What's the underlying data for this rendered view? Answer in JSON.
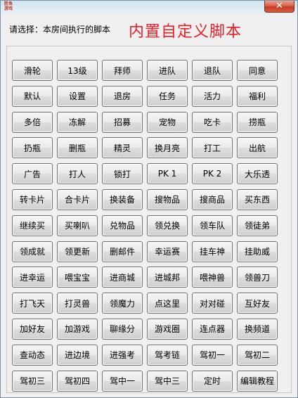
{
  "window": {
    "icon_text": "胜鱼\n游戏",
    "close_label": "✕"
  },
  "header": {
    "prompt": "请选择：本房间执行的脚本",
    "title": "内置自定义脚本"
  },
  "buttons": [
    "滑轮",
    "13级",
    "拜师",
    "进队",
    "退队",
    "同意",
    "默认",
    "设置",
    "退房",
    "任务",
    "活力",
    "福利",
    "多倍",
    "冻解",
    "招募",
    "宠物",
    "吃卡",
    "捞瓶",
    "扔瓶",
    "删瓶",
    "精灵",
    "换月亮",
    "打工",
    "出航",
    "广告",
    "打人",
    "锁打",
    "PK 1",
    "PK 2",
    "大乐透",
    "转卡片",
    "合卡片",
    "换装备",
    "搜物品",
    "搜商品",
    "买东西",
    "继续买",
    "买喇叭",
    "兑物品",
    "领兑换",
    "领车队",
    "领徒弟",
    "领成就",
    "领更新",
    "删邮件",
    "幸运赛",
    "挂车神",
    "挂助威",
    "进幸运",
    "喂宝宝",
    "进商城",
    "进城邦",
    "喂神兽",
    "领兽刀",
    "打飞天",
    "打灵兽",
    "领魔力",
    "点这里",
    "对对碰",
    "互好友",
    "加好友",
    "加游戏",
    "聊缘分",
    "游戏圈",
    "连点器",
    "换频道",
    "查动态",
    "进边境",
    "进强考",
    "驾考链",
    "驾初一",
    "驾初二",
    "驾初三",
    "驾初四",
    "驾中一",
    "驾中三",
    "定时",
    "编辑教程"
  ]
}
